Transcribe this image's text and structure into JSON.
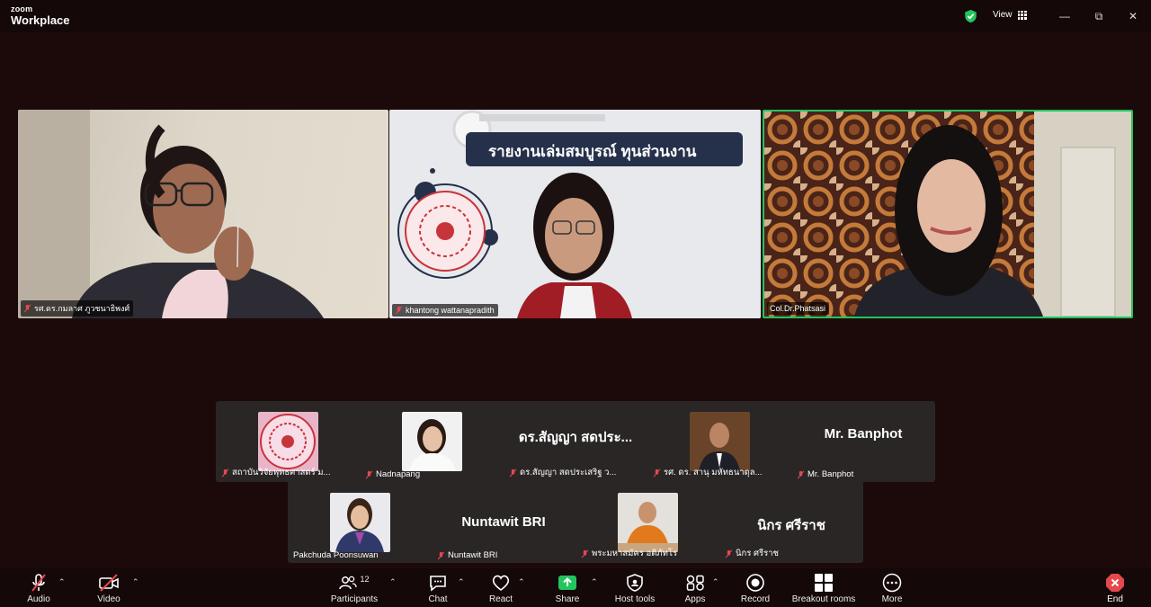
{
  "app": {
    "logo_small": "zoom",
    "logo_big": "Workplace",
    "view_label": "View"
  },
  "colors": {
    "active_speaker": "#22c55e",
    "muted": "#e5484d",
    "share": "#22c55e",
    "end": "#e5484d"
  },
  "videos": [
    {
      "name": "รศ.ดร.กมลาศ ภูวชนาธิพงศ์"
    },
    {
      "name": "khantong wattanapradith",
      "slide_title": "รายงานเล่มสมบูรณ์ ทุนส่วนงาน"
    },
    {
      "name": "Col.Dr.Phatsasi"
    }
  ],
  "gallery_row1": [
    {
      "name": "สถาบันวิจัยพุทธศาสตร์ ม...",
      "big": ""
    },
    {
      "name": "Nadnapang",
      "big": ""
    },
    {
      "name": "ดร.สัญญา สดประเสริฐ ว...",
      "big": "ดร.สัญญา สดประ..."
    },
    {
      "name": "รศ. ดร. สานุ มหัทธนาดุล...",
      "big": ""
    },
    {
      "name": "Mr. Banphot",
      "big": "Mr. Banphot"
    }
  ],
  "gallery_row2": [
    {
      "name": "Pakchuda Poonsuwan",
      "big": ""
    },
    {
      "name": "Nuntawit BRI",
      "big": "Nuntawit BRI"
    },
    {
      "name": "พระมหาสมัคร อติภัทโร",
      "big": ""
    },
    {
      "name": "นิกร ศรีราช",
      "big": "นิกร ศรีราช"
    }
  ],
  "toolbar": {
    "audio": "Audio",
    "video": "Video",
    "participants": "Participants",
    "participant_count": "12",
    "chat": "Chat",
    "react": "React",
    "share": "Share",
    "host_tools": "Host tools",
    "apps": "Apps",
    "record": "Record",
    "breakout": "Breakout rooms",
    "more": "More",
    "end": "End"
  },
  "icons": [
    "shield-check-icon",
    "grid-icon",
    "minimize-icon",
    "restore-icon",
    "close-icon",
    "mic-muted-icon",
    "video-off-icon",
    "participants-icon",
    "chat-icon",
    "heart-icon",
    "share-up-icon",
    "shield-icon",
    "apps-icon",
    "record-icon",
    "grid-4-icon",
    "more-icon",
    "end-icon"
  ]
}
